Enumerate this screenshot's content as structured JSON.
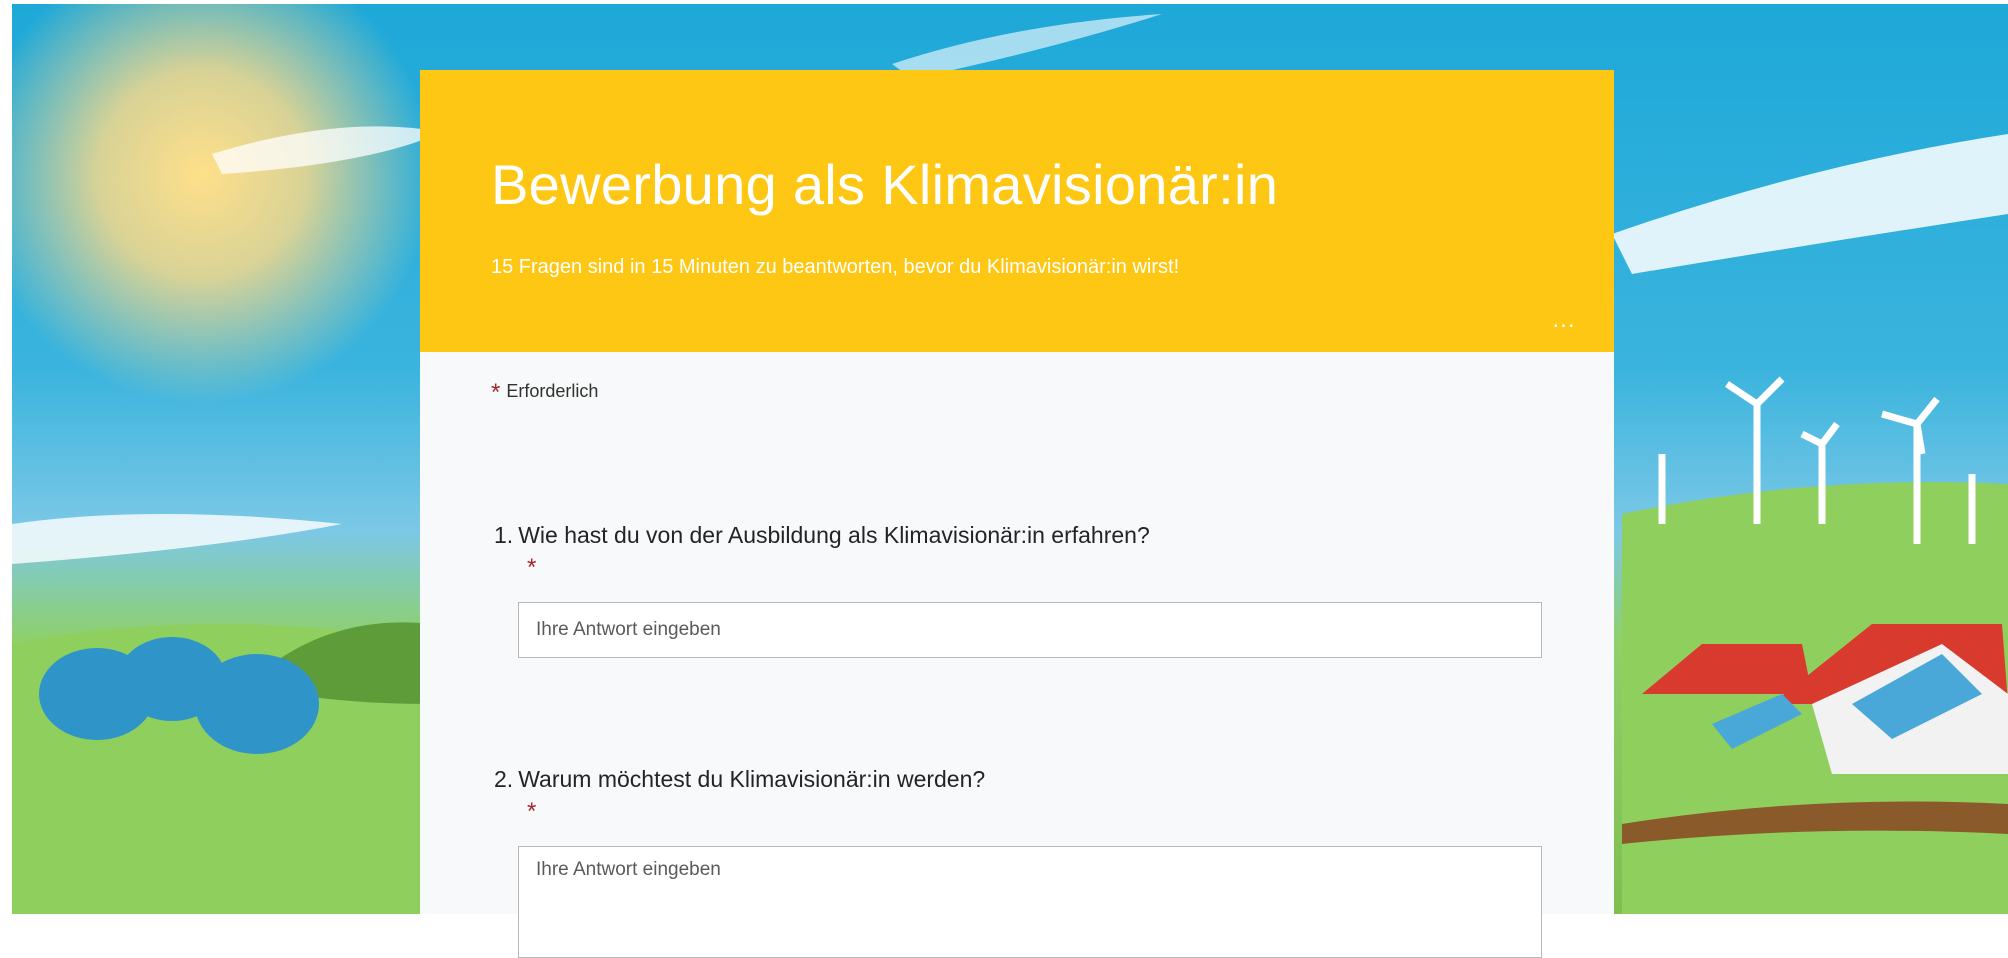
{
  "form": {
    "title": "Bewerbung als Klimavisionär:in",
    "subtitle": "15 Fragen sind in 15 Minuten zu beantworten, bevor du Klimavisionär:in wirst!",
    "more_label": "...",
    "required_star": "*",
    "required_label": "Erforderlich",
    "banner_color": "#fec713"
  },
  "questions": [
    {
      "number": "1.",
      "title": "Wie hast du von der Ausbildung als Klimavisionär:in erfahren?",
      "required_star": "*",
      "placeholder": "Ihre Antwort eingeben"
    },
    {
      "number": "2.",
      "title": "Warum möchtest du Klimavisionär:in werden?",
      "required_star": "*",
      "placeholder": "Ihre Antwort eingeben"
    }
  ],
  "icons": {
    "more": "more-options-icon",
    "required": "required-star-icon"
  }
}
